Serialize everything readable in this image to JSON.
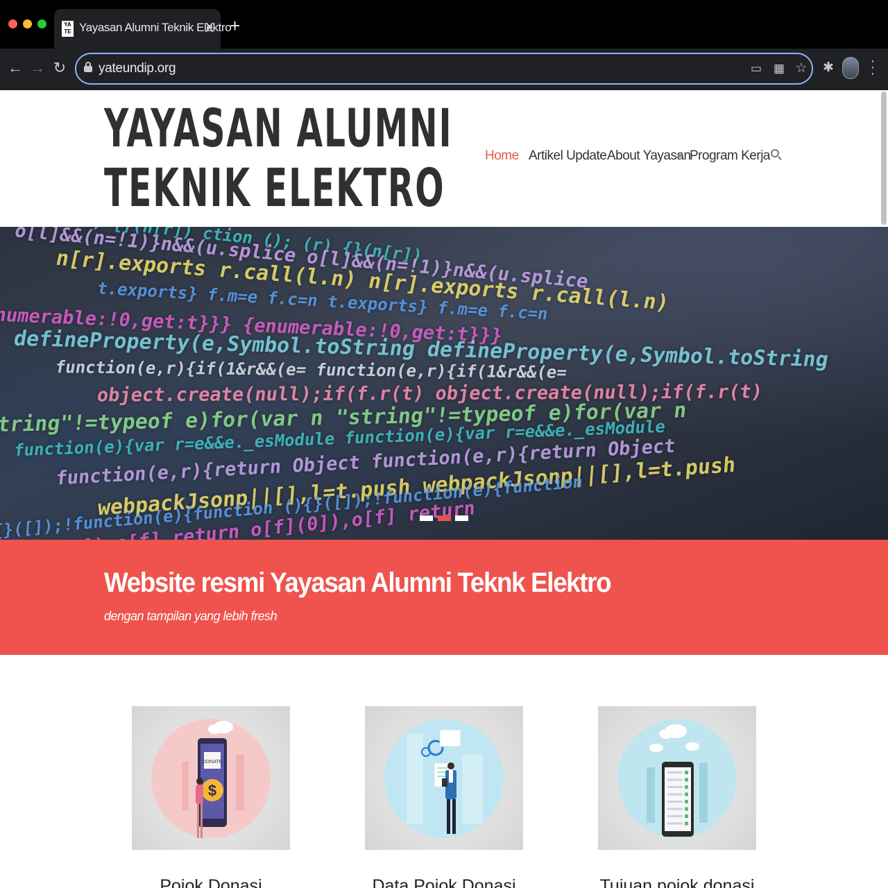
{
  "browser": {
    "tab": {
      "favicon": "YA TE",
      "title": "Yayasan Alumni Teknik Elektro",
      "close": "X"
    },
    "new_tab": "+",
    "url": "yateundip.org",
    "icons": [
      "back-arrow-icon",
      "forward-arrow-icon",
      "reload-icon",
      "lock-icon",
      "install-app-icon",
      "qr-code-icon",
      "bookmark-star-icon",
      "extensions-puzzle-icon",
      "profile-avatar",
      "more-menu-icon"
    ]
  },
  "site": {
    "logo": {
      "line1": "YAYASAN ALUMNI",
      "line2": "TEKNIK ELEKTRO"
    },
    "nav": {
      "home": "Home",
      "artikel": "Artikel Update",
      "about": "About Yayasan",
      "program": "Program Kerja",
      "active": "Home"
    },
    "accent_color": "#f0524d",
    "hero": {
      "slides": 3,
      "active_slide": 2,
      "code_text": [
        "ction  ();  (r)  {}(n[r])",
        "o[l]&&(n=!1)}n&&(u.splice",
        "n[r].exports  r.call(l.n)",
        "t.exports}  f.m=e  f.c=n",
        "{enumerable:!0,get:t}}}",
        "defineProperty(e,Symbol.toString",
        "function(e,r){if(1&r&&(e=",
        "object.create(null);if(f.r(t)",
        "\"string\"!=typeof e)for(var n",
        "function(e){var r=e&&e._esModule",
        "function(e,r){return Object",
        "webpackJsonp||[],l=t.push",
        "(){}([]);!function(e){function",
        "o[f](0]),o[f]  return"
      ]
    },
    "tagline": {
      "title": "Website resmi Yayasan Alumni Teknk Elektro",
      "subtitle": "dengan tampilan yang lebih fresh"
    },
    "cards": [
      {
        "title": "Pojok Donasi",
        "icon": "donate-phone-illustration",
        "badge": "DONATE",
        "symbol": "$"
      },
      {
        "title": "Data Pojok Donasi",
        "icon": "businessman-data-illustration"
      },
      {
        "title": "Tujuan pojok donasi",
        "icon": "checklist-phone-illustration"
      }
    ]
  }
}
